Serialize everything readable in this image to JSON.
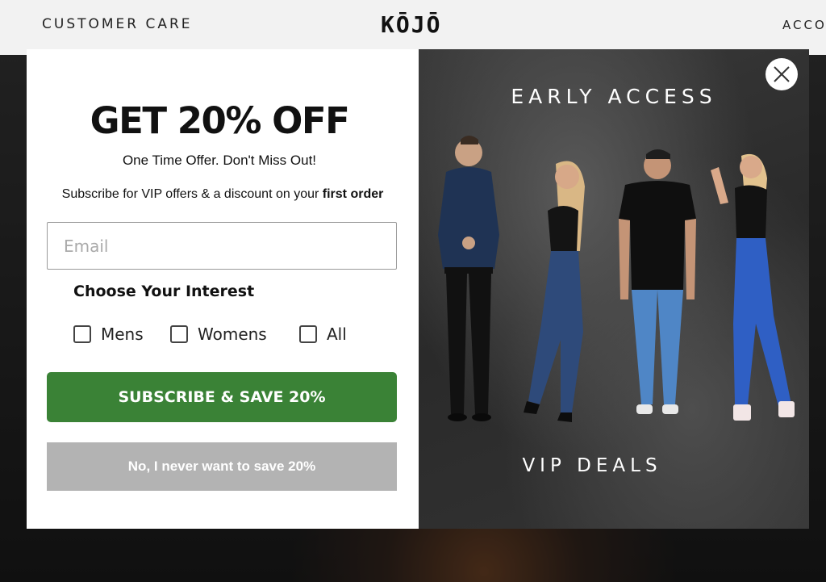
{
  "site": {
    "nav_left": "CUSTOMER CARE",
    "logo": "KŌJŌ",
    "nav_right": "ACCO"
  },
  "popup": {
    "headline": "GET 20% OFF",
    "subheadline": "One Time Offer. Don't Miss Out!",
    "vip_text": "Subscribe for VIP offers & a discount on your ",
    "vip_text_bold": "first order",
    "email_placeholder": "Email",
    "email_value": "",
    "interest_title": "Choose Your Interest",
    "interests": [
      {
        "label": "Mens",
        "checked": false
      },
      {
        "label": "Womens",
        "checked": false
      },
      {
        "label": "All",
        "checked": false
      }
    ],
    "subscribe_label": "SUBSCRIBE & SAVE 20%",
    "decline_label": "No, I never want to save 20%",
    "image_top_text": "EARLY ACCESS",
    "image_bottom_text": "VIP DEALS",
    "close_icon": "close-icon"
  },
  "colors": {
    "subscribe_green": "#3a8236",
    "decline_gray": "#b3b3b3",
    "header_bg": "#f2f2f2"
  }
}
